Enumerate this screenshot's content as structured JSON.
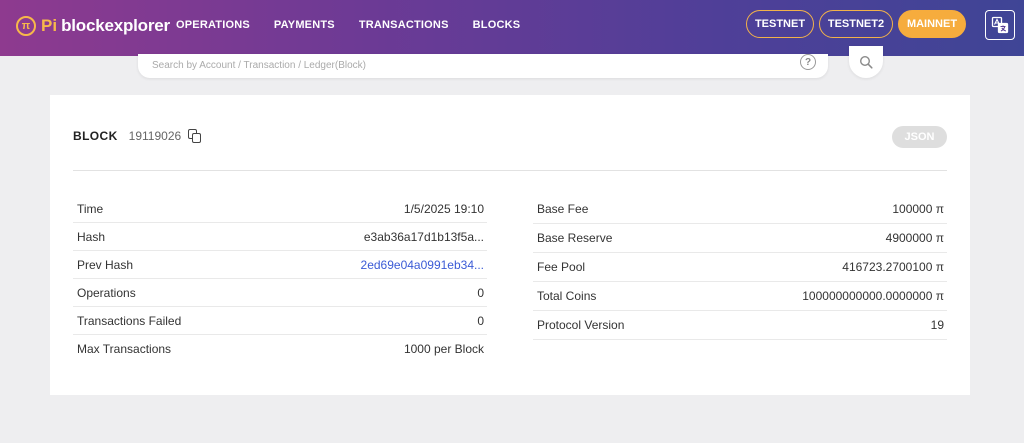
{
  "brand": {
    "pi": "Pi",
    "name": "blockexplorer"
  },
  "nav": [
    {
      "label": "OPERATIONS"
    },
    {
      "label": "PAYMENTS"
    },
    {
      "label": "TRANSACTIONS"
    },
    {
      "label": "BLOCKS"
    }
  ],
  "networks": {
    "testnet": "TESTNET",
    "testnet2": "TESTNET2",
    "mainnet": "MAINNET",
    "active": "MAINNET"
  },
  "search": {
    "placeholder": "Search by Account / Transaction / Ledger(Block)",
    "value": "",
    "help_glyph": "?"
  },
  "block": {
    "label": "BLOCK",
    "number": "19119026",
    "json_label": "JSON"
  },
  "left_rows": [
    {
      "label": "Time",
      "value": "1/5/2025 19:10"
    },
    {
      "label": "Hash",
      "value": "e3ab36a17d1b13f5a..."
    },
    {
      "label": "Prev Hash",
      "value": "2ed69e04a0991eb34..."
    },
    {
      "label": "Operations",
      "value": "0"
    },
    {
      "label": "Transactions Failed",
      "value": "0"
    },
    {
      "label": "Max Transactions",
      "value": "1000 per Block"
    }
  ],
  "right_rows": [
    {
      "label": "Base Fee",
      "value": "100000 π"
    },
    {
      "label": "Base Reserve",
      "value": "4900000 π"
    },
    {
      "label": "Fee Pool",
      "value": "416723.2700100 π"
    },
    {
      "label": "Total Coins",
      "value": "100000000000.0000000 π"
    },
    {
      "label": "Protocol Version",
      "value": "19"
    }
  ],
  "colors": {
    "accent": "#f6ac3d",
    "link": "#3b5bd6",
    "header_start": "#8e3a8f",
    "header_end": "#3f4596"
  },
  "icons": [
    "pi-logo-icon",
    "translate-icon",
    "help-icon",
    "search-icon",
    "copy-icon"
  ]
}
